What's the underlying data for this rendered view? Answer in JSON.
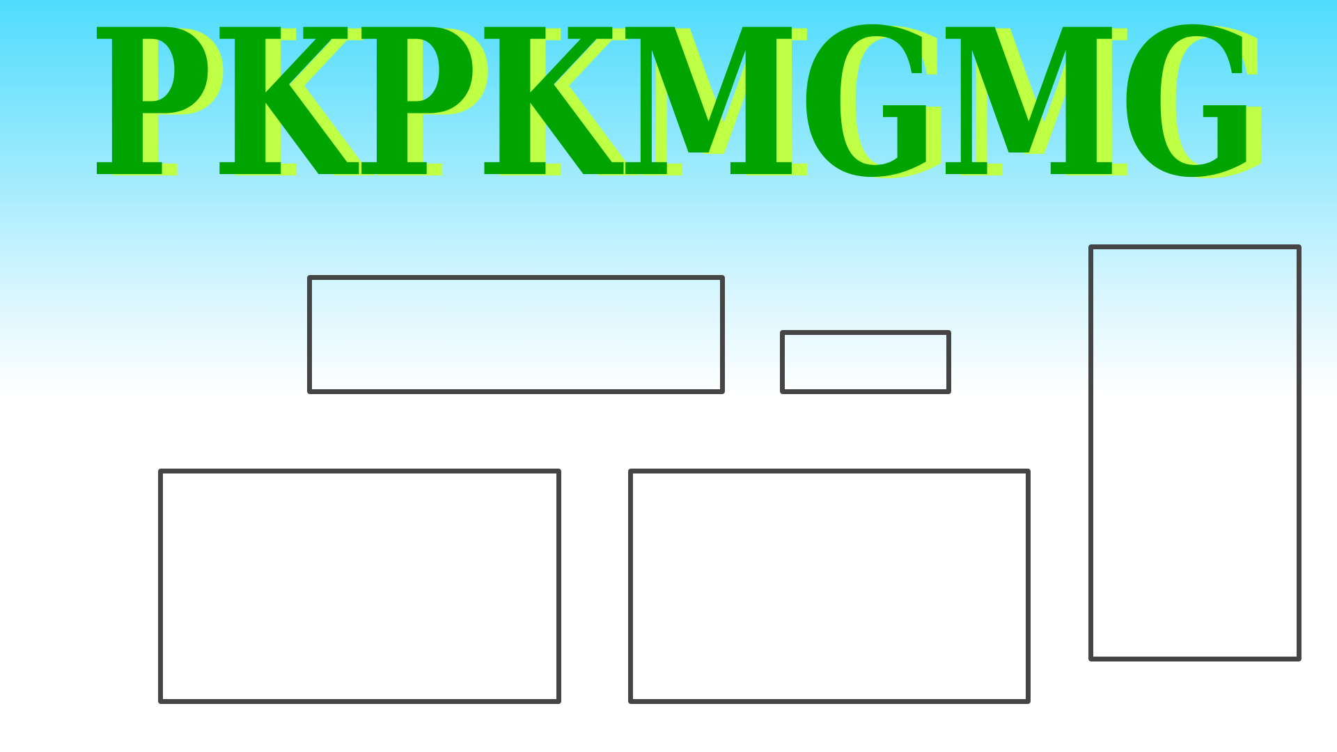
{
  "title": {
    "text": "PKPKMGMG",
    "fill_color": "#00a400",
    "shadow_color": "#bfff44"
  },
  "placeholders": {
    "border_color": "#454545",
    "count": 5
  }
}
